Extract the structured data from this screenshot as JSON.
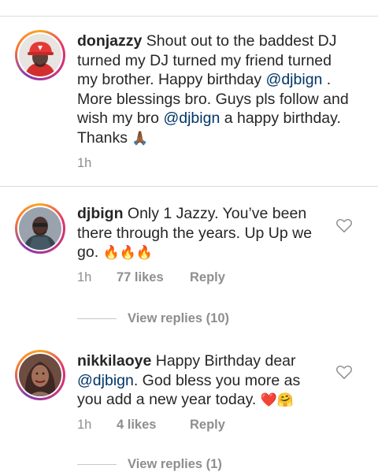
{
  "comments": [
    {
      "username": "donjazzy",
      "text_1": " Shout out to the baddest DJ turned my DJ turned my friend turned my brother. Happy birthday ",
      "mention_1": "@djbign",
      "text_2": " . More blessings bro. Guys pls follow and wish my bro ",
      "mention_2": "@djbign",
      "text_3": " a happy birthday. Thanks ",
      "emoji": "🙏🏾",
      "time": "1h"
    },
    {
      "username": "djbign",
      "text_1": " Only 1 Jazzy.  You’ve been there through the years. Up Up we go. ",
      "emoji": "🔥🔥🔥",
      "time": "1h",
      "likes": "77 likes",
      "reply": "Reply",
      "view_replies": "View replies (10)"
    },
    {
      "username": "nikkilaoye",
      "text_1": " Happy Birthday dear ",
      "mention_1": "@djbign",
      "text_2": ". God bless you more as you add a new year today. ",
      "emoji_heart": "❤️",
      "emoji_hug": "🤗",
      "time": "1h",
      "likes": "4 likes",
      "reply": "Reply",
      "view_replies": "View replies (1)"
    }
  ],
  "colors": {
    "text": "#262626",
    "mention": "#003569",
    "meta": "#8e8e8e",
    "divider": "#dbdbdb"
  },
  "icons": {
    "like": "heart-outline-icon"
  }
}
